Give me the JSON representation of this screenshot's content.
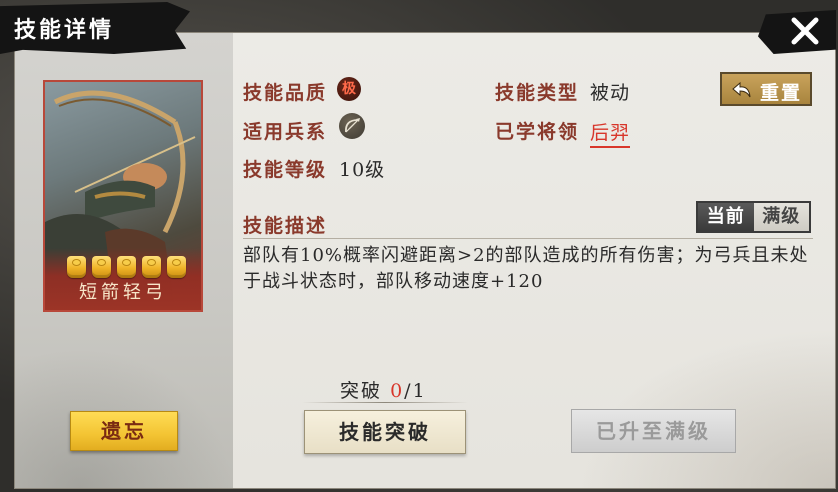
{
  "window": {
    "title": "技能详情"
  },
  "skill_card": {
    "name": "短箭轻弓",
    "stars": 5
  },
  "left": {
    "forget_label": "遗忘"
  },
  "info": {
    "quality_label": "技能品质",
    "quality_badge": "极",
    "type_label": "技能类型",
    "type_value": "被动",
    "troop_label": "适用兵系",
    "troop_icon": "bow-icon",
    "learned_label": "已学将领",
    "learned_value": "后羿",
    "level_label": "技能等级",
    "level_value": "10级"
  },
  "reset_label": "重置",
  "description": {
    "label": "技能描述",
    "text": "部队有10%概率闪避距离>2的部队造成的所有伤害；为弓兵且未处于战斗状态时，部队移动速度+120",
    "toggle": {
      "current": "当前",
      "max": "满级",
      "selected": "current"
    }
  },
  "breakthrough": {
    "label": "突破",
    "current": "0",
    "separator": "/",
    "total": "1",
    "button_label": "技能突破"
  },
  "max_button_label": "已升至满级",
  "colors": {
    "accent_red": "#d8362a",
    "label_brown": "#8a3a2c",
    "gold": "#f3c433"
  }
}
